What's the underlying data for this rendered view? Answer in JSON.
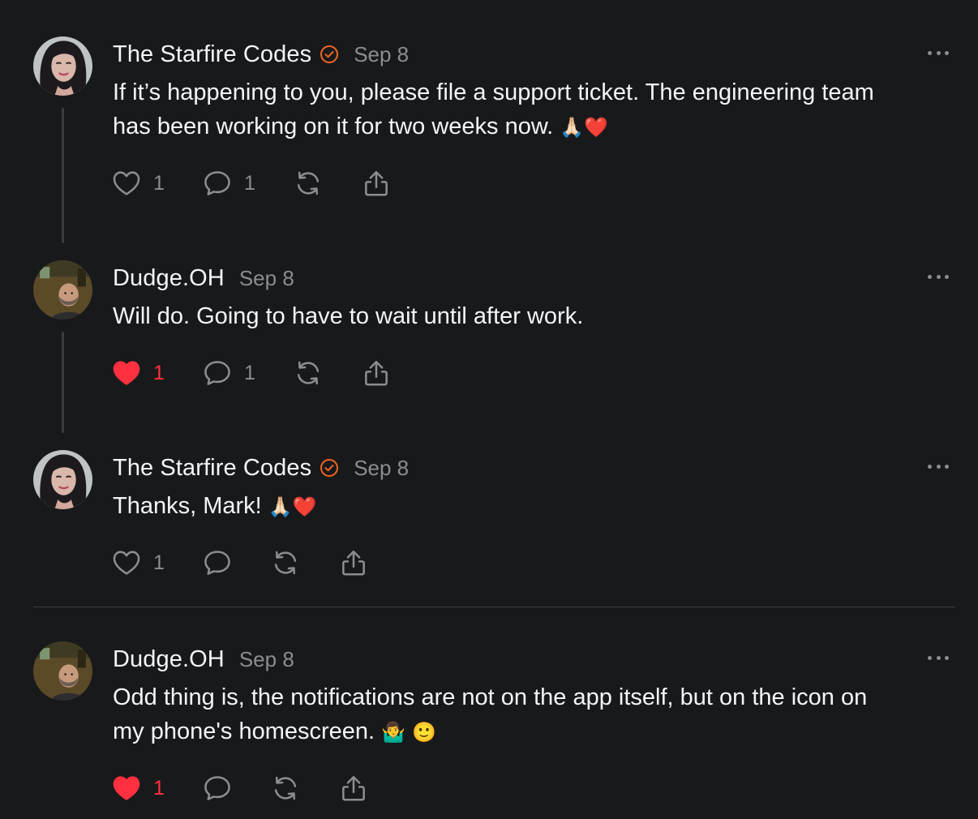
{
  "posts": [
    {
      "author": "The Starfire Codes",
      "verified": true,
      "time": "Sep 8",
      "text_lines": [
        "If it’s happening to you, please file a support ticket. The engineering team",
        "has been working on it for two weeks now."
      ],
      "emoji": [
        "🙏🏻",
        "❤️"
      ],
      "likes": "1",
      "liked": false,
      "replies": "1",
      "avatar": "woman-dark-hair"
    },
    {
      "author": "Dudge.OH",
      "verified": false,
      "time": "Sep 8",
      "text_lines": [
        "Will do. Going to have to wait until after work."
      ],
      "emoji": [],
      "likes": "1",
      "liked": true,
      "replies": "1",
      "avatar": "man-bald-beard"
    },
    {
      "author": "The Starfire Codes",
      "verified": true,
      "time": "Sep 8",
      "text_lines": [
        "Thanks, Mark!"
      ],
      "emoji": [
        "🙏🏻",
        "❤️"
      ],
      "likes": "1",
      "liked": false,
      "replies": "",
      "avatar": "woman-dark-hair"
    },
    {
      "author": "Dudge.OH",
      "verified": false,
      "time": "Sep 8",
      "text_lines": [
        "Odd thing is, the notifications are not on the app itself, but on the icon on",
        "my phone's homescreen."
      ],
      "emoji": [
        "🤷‍♂️",
        "🙂"
      ],
      "likes": "1",
      "liked": true,
      "replies": "",
      "avatar": "man-bald-beard"
    }
  ],
  "colors": {
    "background": "#18191b",
    "text": "#f3f5f7",
    "muted": "#8a8d91",
    "like_red": "#ff3040",
    "verified_orange": "#f26522",
    "thread_line": "#3a3c40"
  }
}
